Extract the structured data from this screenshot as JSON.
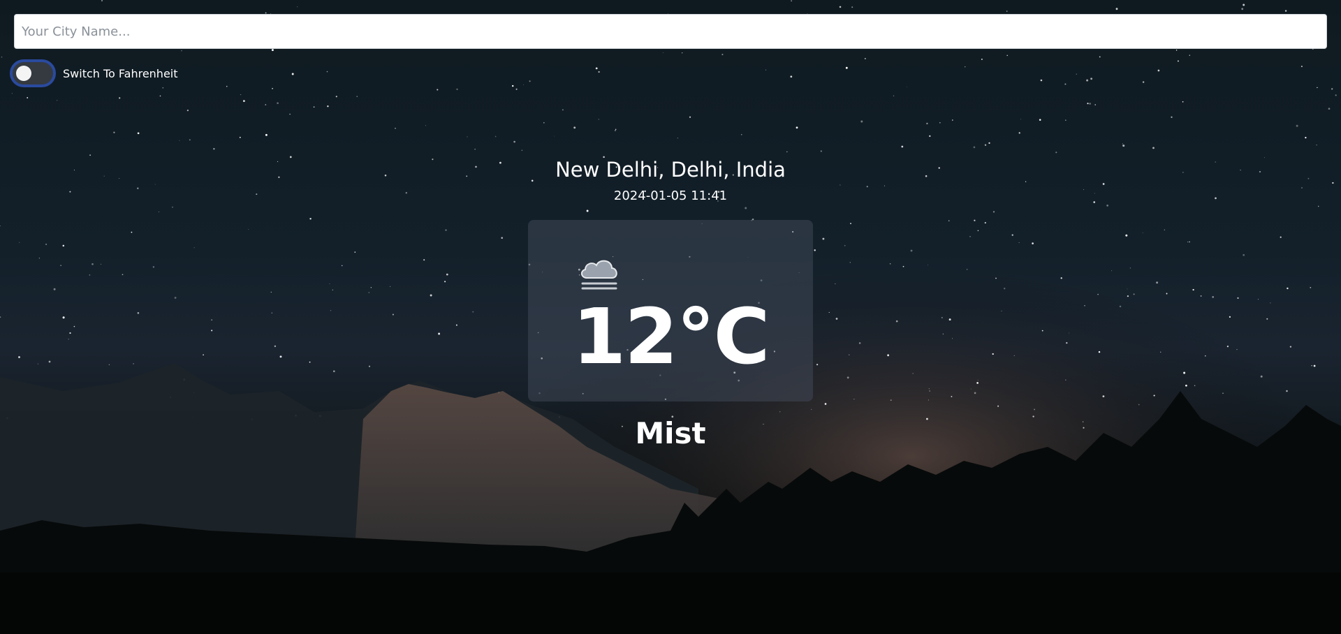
{
  "search": {
    "placeholder": "Your City Name...",
    "value": ""
  },
  "unit_toggle": {
    "label": "Switch To Fahrenheit",
    "checked": false
  },
  "weather": {
    "location": "New Delhi, Delhi, India",
    "datetime": "2024-01-05 11:41",
    "temperature": "12°C",
    "condition": "Mist",
    "icon": "mist-icon"
  },
  "colors": {
    "toggle_border": "#2a4a9e",
    "toggle_track": "#343a40",
    "card_bg": "rgba(70, 80, 95, 0.45)"
  }
}
